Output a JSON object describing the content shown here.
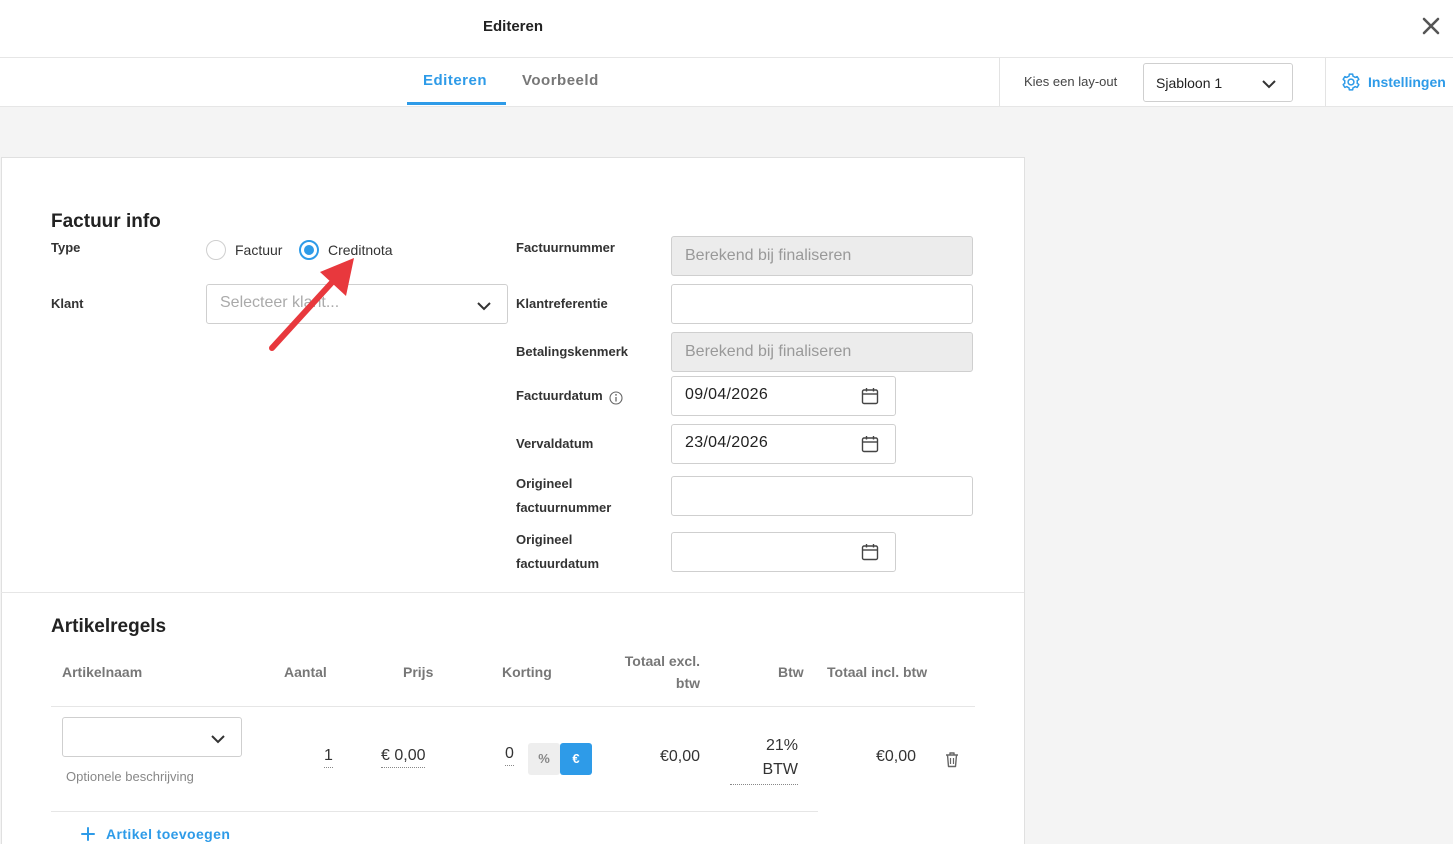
{
  "header": {
    "title": "Editeren"
  },
  "tabs": [
    {
      "label": "Editeren",
      "active": true
    },
    {
      "label": "Voorbeeld",
      "active": false
    }
  ],
  "layout": {
    "label": "Kies een lay-out",
    "selected": "Sjabloon 1"
  },
  "settings": {
    "label": "Instellingen",
    "icon": "gear-icon"
  },
  "invoice_info": {
    "heading": "Factuur info",
    "type_label": "Type",
    "type_options": [
      {
        "label": "Factuur",
        "selected": false
      },
      {
        "label": "Creditnota",
        "selected": true
      }
    ],
    "client_label": "Klant",
    "client_placeholder": "Selecteer klant...",
    "invoice_number_label": "Factuurnummer",
    "invoice_number_value": "Berekend bij finaliseren",
    "client_reference_label": "Klantreferentie",
    "client_reference_value": "",
    "payment_reference_label": "Betalingskenmerk",
    "payment_reference_value": "Berekend bij finaliseren",
    "invoice_date_label": "Factuurdatum",
    "invoice_date_value": "09/04/2026",
    "due_date_label": "Vervaldatum",
    "due_date_value": "23/04/2026",
    "original_invoice_number_label_1": "Origineel",
    "original_invoice_number_label_2": "factuurnummer",
    "original_invoice_number_value": "",
    "original_invoice_date_label_1": "Origineel",
    "original_invoice_date_label_2": "factuurdatum",
    "original_invoice_date_value": ""
  },
  "items": {
    "heading": "Artikelregels",
    "columns": {
      "name": "Artikelnaam",
      "qty": "Aantal",
      "price": "Prijs",
      "discount": "Korting",
      "total_excl_1": "Totaal excl.",
      "total_excl_2": "btw",
      "vat": "Btw",
      "total_incl": "Totaal incl. btw"
    },
    "rows": [
      {
        "name": "",
        "description_placeholder": "Optionele beschrijving",
        "qty": "1",
        "price": "€ 0,00",
        "discount": "0",
        "discount_pct_label": "%",
        "discount_eur_label": "€",
        "total_excl": "€0,00",
        "vat_1": "21%",
        "vat_2": "BTW",
        "total_incl": "€0,00"
      }
    ],
    "add_label": "Artikel toevoegen"
  },
  "colors": {
    "accent": "#2e9be8",
    "annotation_arrow": "#e8383d"
  }
}
